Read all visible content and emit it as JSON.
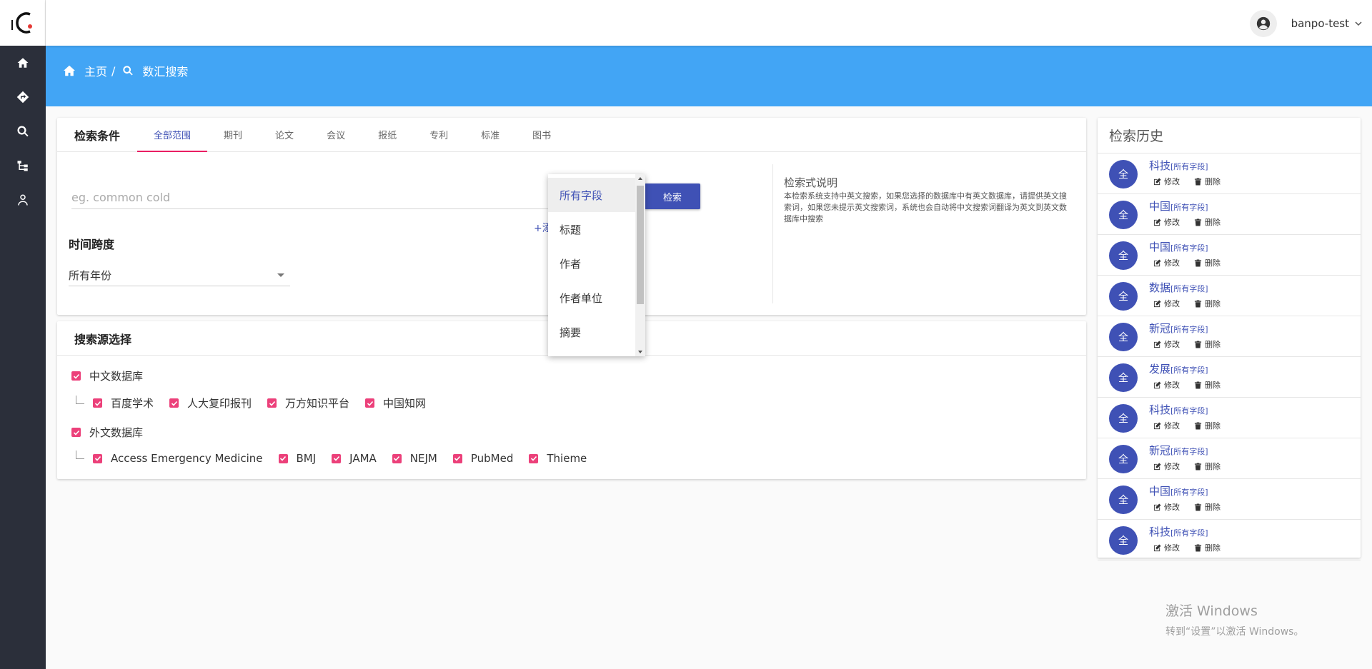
{
  "app": {
    "logo_text": "C"
  },
  "sidebar": {
    "items": [
      {
        "icon": "home-icon"
      },
      {
        "icon": "direction-icon"
      },
      {
        "icon": "search-icon"
      },
      {
        "icon": "sitemap-icon"
      },
      {
        "icon": "user-icon"
      }
    ]
  },
  "topbar": {
    "username": "banpo-test"
  },
  "breadcrumb": {
    "home": "主页",
    "separator": "/",
    "current": "数汇搜索"
  },
  "search_panel": {
    "title": "检索条件",
    "tabs": [
      "全部范围",
      "期刊",
      "论文",
      "会议",
      "报纸",
      "专利",
      "标准",
      "图书"
    ],
    "active_tab": "全部范围",
    "input_placeholder": "eg. common cold",
    "add_link": "+添",
    "search_button": "检索",
    "time_label": "时间跨度",
    "year_select": "所有年份",
    "help_title": "检索式说明",
    "help_text": "本检索系统支持中英文搜索，如果您选择的数据库中有英文数据库，请提供英文搜索词，如果您未提示英文搜索词，系统也会自动将中文搜索词翻译为英文到英文数据库中搜索"
  },
  "field_dropdown": {
    "options": [
      "所有字段",
      "标题",
      "作者",
      "作者单位",
      "摘要"
    ],
    "selected": "所有字段"
  },
  "source_panel": {
    "title": "搜索源选择",
    "groups": [
      {
        "label": "中文数据库",
        "items": [
          "百度学术",
          "人大复印报刊",
          "万方知识平台",
          "中国知网"
        ]
      },
      {
        "label": "外文数据库",
        "items": [
          "Access Emergency Medicine",
          "BMJ",
          "JAMA",
          "NEJM",
          "PubMed",
          "Thieme"
        ]
      }
    ]
  },
  "history": {
    "title": "检索历史",
    "badge": "全",
    "edit_label": "修改",
    "delete_label": "删除",
    "items": [
      {
        "term": "科技",
        "field": "[所有字段]"
      },
      {
        "term": "中国",
        "field": "[所有字段]"
      },
      {
        "term": "中国",
        "field": "[所有字段]"
      },
      {
        "term": "数据",
        "field": "[所有字段]"
      },
      {
        "term": "新冠",
        "field": "[所有字段]"
      },
      {
        "term": "发展",
        "field": "[所有字段]"
      },
      {
        "term": "科技",
        "field": "[所有字段]"
      },
      {
        "term": "新冠",
        "field": "[所有字段]"
      },
      {
        "term": "中国",
        "field": "[所有字段]"
      },
      {
        "term": "科技",
        "field": "[所有字段]"
      }
    ]
  },
  "watermark": {
    "line1": "激活 Windows",
    "line2": "转到“设置”以激活 Windows。"
  },
  "colors": {
    "primary": "#3f51b5",
    "header": "#42a5f5",
    "accent": "#e91e63",
    "checkbox": "#ec407a",
    "sidebar": "#2b2f3a"
  }
}
